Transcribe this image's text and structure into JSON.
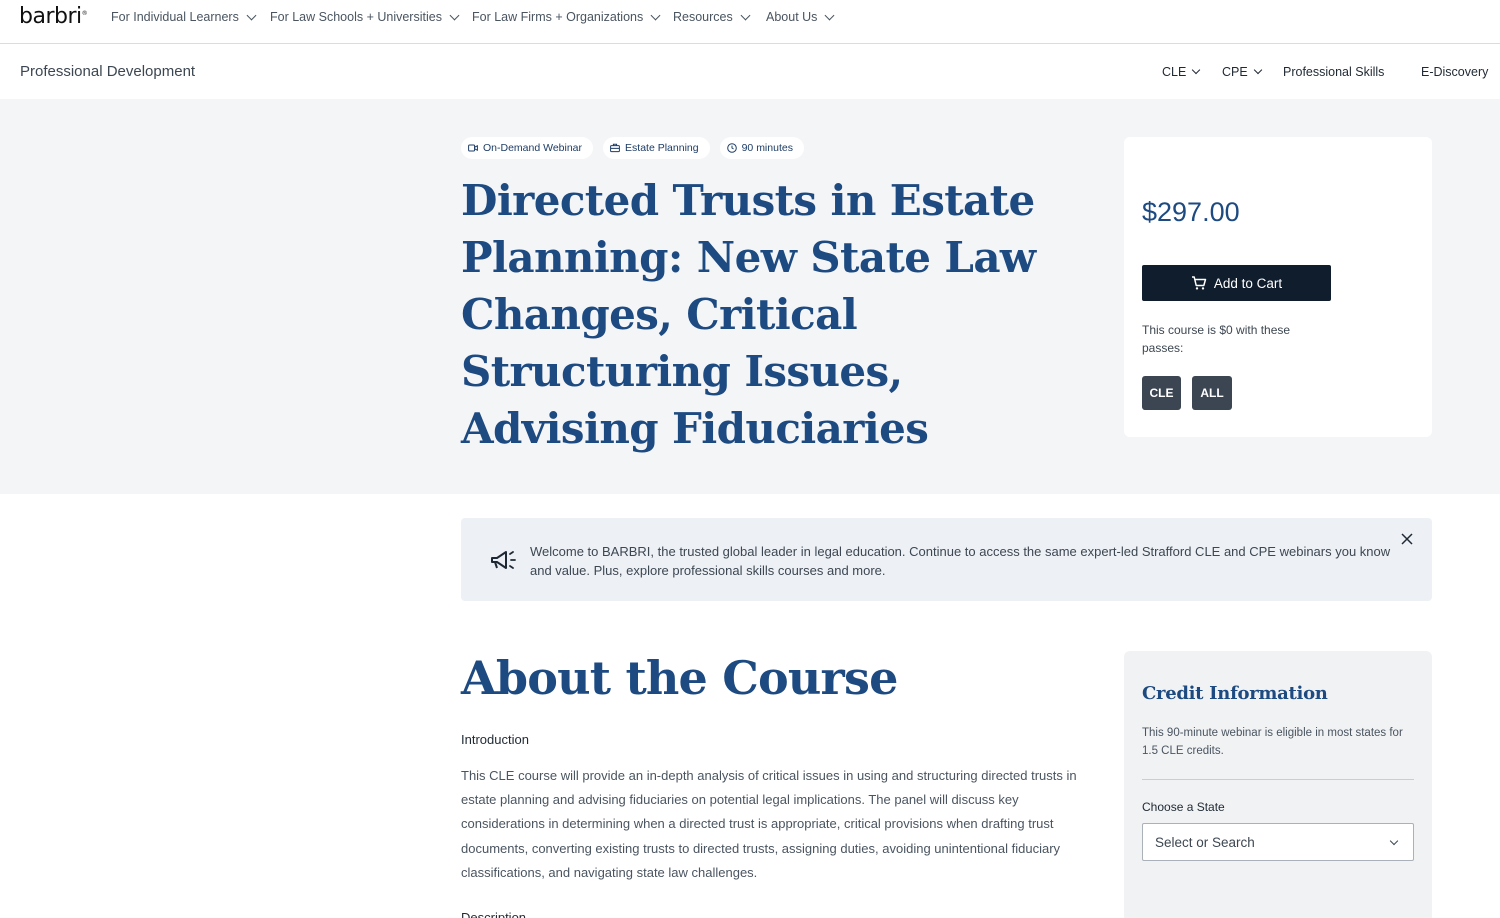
{
  "brand": {
    "logo": "barbri"
  },
  "topnav": {
    "items": [
      {
        "label": "For Individual Learners"
      },
      {
        "label": "For Law Schools + Universities"
      },
      {
        "label": "For Law Firms + Organizations"
      },
      {
        "label": "Resources"
      },
      {
        "label": "About Us"
      }
    ]
  },
  "subnav": {
    "title": "Professional Development",
    "items": [
      {
        "label": "CLE"
      },
      {
        "label": "CPE"
      },
      {
        "label": "Professional Skills"
      },
      {
        "label": "E-Discovery"
      }
    ]
  },
  "course": {
    "tags": [
      {
        "label": "On-Demand Webinar",
        "icon": "video-icon"
      },
      {
        "label": "Estate Planning",
        "icon": "briefcase-icon"
      },
      {
        "label": "90 minutes",
        "icon": "clock-icon"
      }
    ],
    "title": "Directed Trusts in Estate Planning: New State Law Changes, Critical Structuring Issues, Advising Fiduciaries"
  },
  "purchase": {
    "price": "$297.00",
    "add_to_cart": "Add to Cart",
    "passes_note": "This course is $0 with these passes:",
    "passes": [
      "CLE",
      "ALL"
    ]
  },
  "banner": {
    "text": "Welcome to BARBRI, the trusted global leader in legal education. Continue to access the same expert-led Strafford CLE and CPE webinars you know and value. Plus, explore professional skills courses and more."
  },
  "about": {
    "title": "About the Course",
    "intro_heading": "Introduction",
    "intro_body": "This CLE course will provide an in-depth analysis of critical issues in using and structuring directed trusts in estate planning and advising fiduciaries on potential legal implications. The panel will discuss key considerations in determining when a directed trust is appropriate, critical provisions when drafting trust documents, converting existing trusts to directed trusts, assigning duties, avoiding unintentional fiduciary classifications, and navigating state law challenges.",
    "description_heading": "Description"
  },
  "credit": {
    "title": "Credit Information",
    "text": "This 90-minute webinar is eligible in most states for 1.5 CLE credits.",
    "state_label": "Choose a State",
    "state_placeholder": "Select or Search"
  },
  "colors": {
    "accent": "#1d4a80",
    "button_dark": "#0f1d2c",
    "pass_button": "#3c4552",
    "hero_bg": "#f4f5f7",
    "banner_bg": "#edf1f6"
  }
}
